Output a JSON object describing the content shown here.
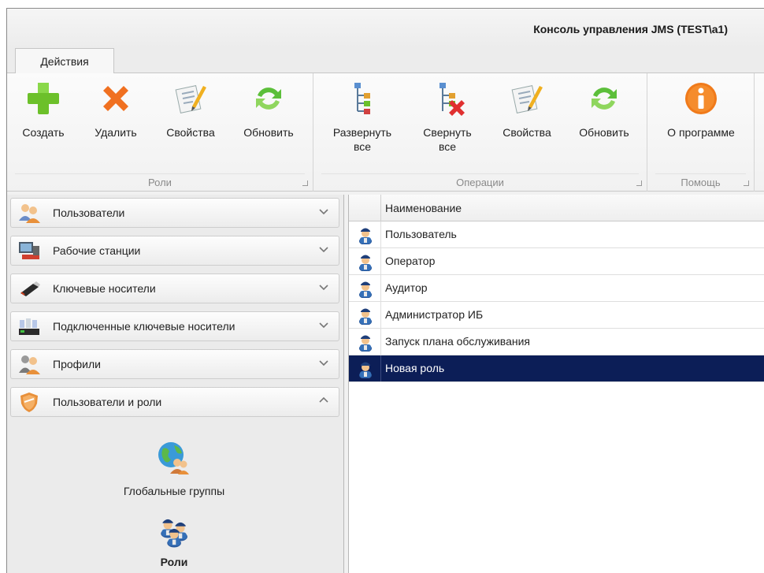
{
  "window": {
    "title": "Консоль управления JMS (TEST\\a1)"
  },
  "ribbon": {
    "tab": "Действия",
    "groups": [
      {
        "label": "Роли",
        "buttons": [
          "Создать",
          "Удалить",
          "Свойства",
          "Обновить"
        ]
      },
      {
        "label": "Операции",
        "buttons": [
          "Развернуть все",
          "Свернуть все",
          "Свойства",
          "Обновить"
        ]
      },
      {
        "label": "Помощь",
        "buttons": [
          "О программе"
        ]
      }
    ]
  },
  "nav": {
    "bars": [
      {
        "label": "Пользователи",
        "icon": "users-icon",
        "expanded": false
      },
      {
        "label": "Рабочие станции",
        "icon": "workstation-icon",
        "expanded": false
      },
      {
        "label": "Ключевые носители",
        "icon": "usb-token-icon",
        "expanded": false
      },
      {
        "label": "Подключенные ключевые носители",
        "icon": "connected-tokens-icon",
        "expanded": false
      },
      {
        "label": "Профили",
        "icon": "profiles-icon",
        "expanded": false
      },
      {
        "label": "Пользователи и роли",
        "icon": "shield-icon",
        "expanded": true
      }
    ],
    "items": [
      {
        "label": "Глобальные группы",
        "icon": "global-groups-icon",
        "active": false
      },
      {
        "label": "Роли",
        "icon": "roles-icon",
        "active": true
      }
    ]
  },
  "grid": {
    "column": "Наименование",
    "rows": [
      {
        "label": "Пользователь",
        "selected": false
      },
      {
        "label": "Оператор",
        "selected": false
      },
      {
        "label": "Аудитор",
        "selected": false
      },
      {
        "label": "Администратор ИБ",
        "selected": false
      },
      {
        "label": "Запуск плана обслуживания",
        "selected": false
      },
      {
        "label": "Новая роль",
        "selected": true
      }
    ]
  },
  "colors": {
    "selection": "#0c1e57",
    "plus": "#6cc02a",
    "delete": "#f07020",
    "refresh": "#5cbf3a",
    "info": "#f07a1a"
  }
}
